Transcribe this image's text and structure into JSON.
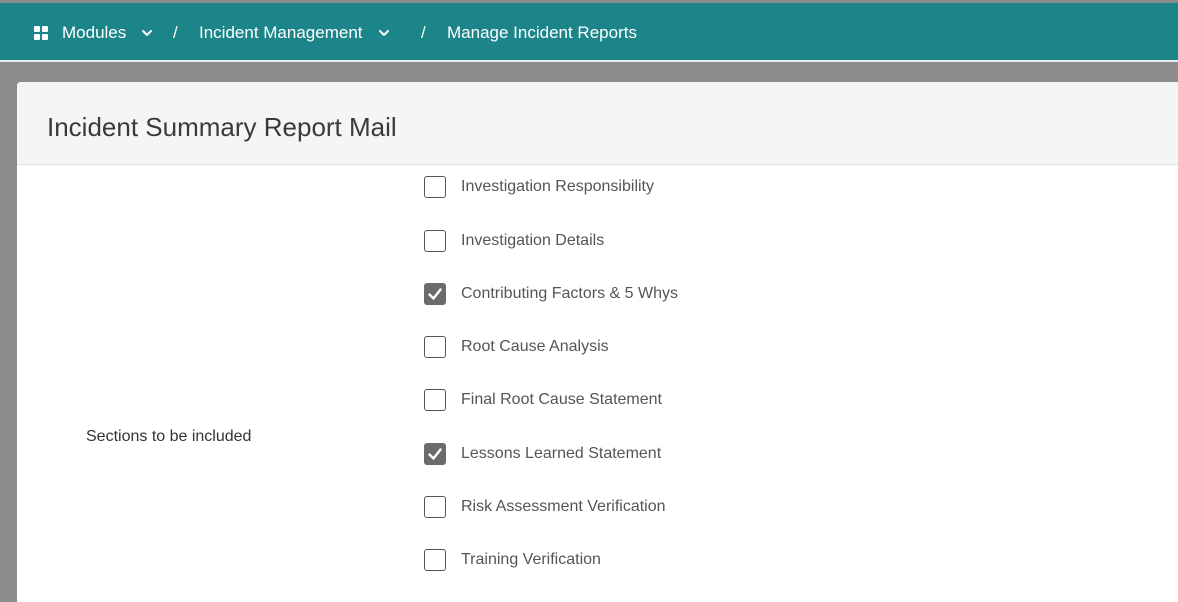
{
  "breadcrumb": {
    "modules": "Modules",
    "incident_management": "Incident Management",
    "manage_reports": "Manage Incident Reports",
    "separator": "/"
  },
  "page": {
    "title": "Incident Summary Report Mail"
  },
  "form": {
    "sections_label": "Sections to be included",
    "options": [
      {
        "label": "Investigation Responsibility",
        "checked": false
      },
      {
        "label": "Investigation Details",
        "checked": false
      },
      {
        "label": "Contributing Factors & 5 Whys",
        "checked": true
      },
      {
        "label": "Root Cause Analysis",
        "checked": false
      },
      {
        "label": "Final Root Cause Statement",
        "checked": false
      },
      {
        "label": "Lessons Learned Statement",
        "checked": true
      },
      {
        "label": "Risk Assessment Verification",
        "checked": false
      },
      {
        "label": "Training Verification",
        "checked": false
      }
    ]
  },
  "colors": {
    "topbar": "#1b8589",
    "checked_box": "#6b6b6b"
  }
}
